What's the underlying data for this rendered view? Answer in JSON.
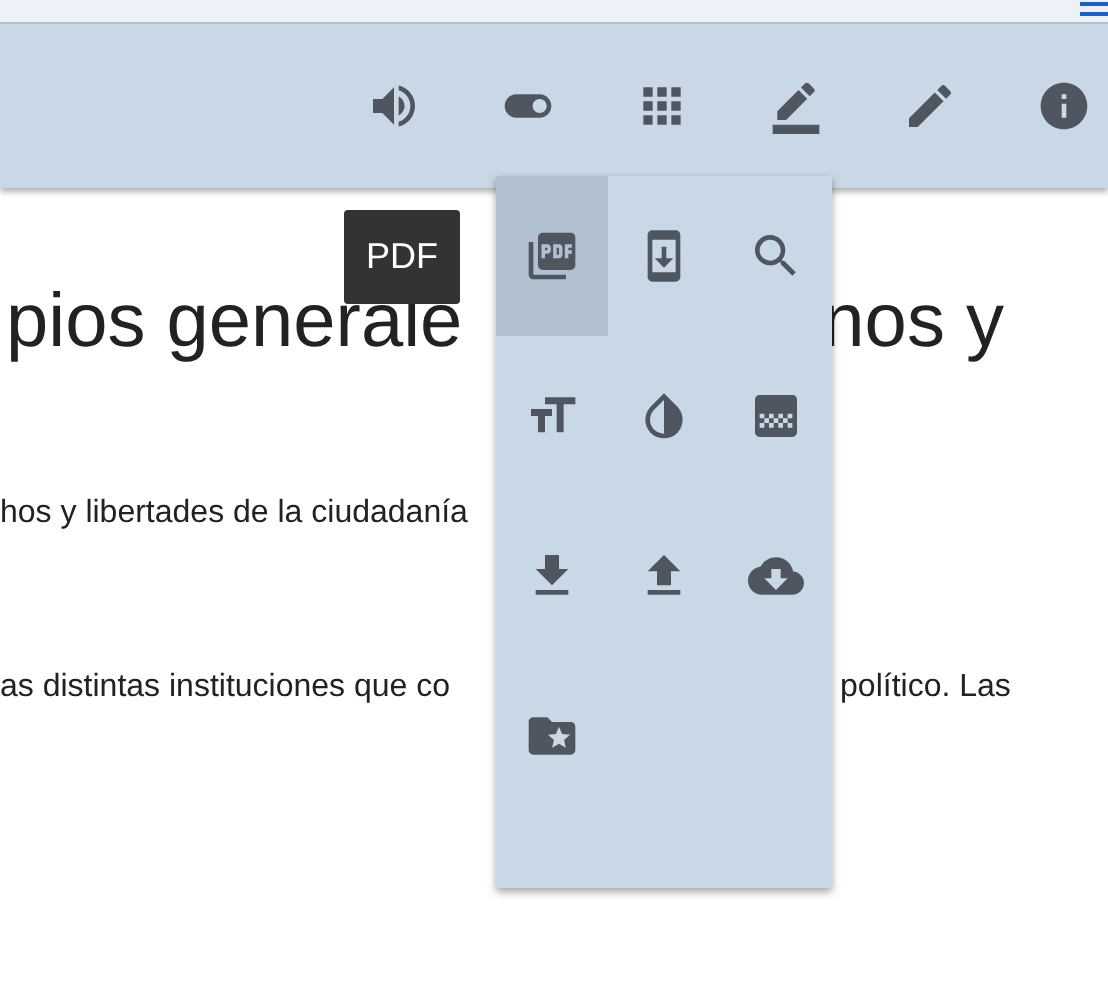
{
  "article": {
    "heading": [
      "pios generale",
      "nos y"
    ],
    "paragraphs": [
      [
        "hos y libertades de la ciudadanía"
      ],
      [
        "as distintas instituciones que co",
        "político. Las"
      ]
    ]
  },
  "tooltip": {
    "text": "PDF"
  },
  "menu": {
    "items": [
      {
        "selected": true
      },
      {
        "selected": false
      },
      {
        "selected": false
      },
      {
        "selected": false
      },
      {
        "selected": false
      },
      {
        "selected": false
      },
      {
        "selected": false
      },
      {
        "selected": false
      },
      {
        "selected": false
      },
      {
        "selected": false
      }
    ]
  }
}
